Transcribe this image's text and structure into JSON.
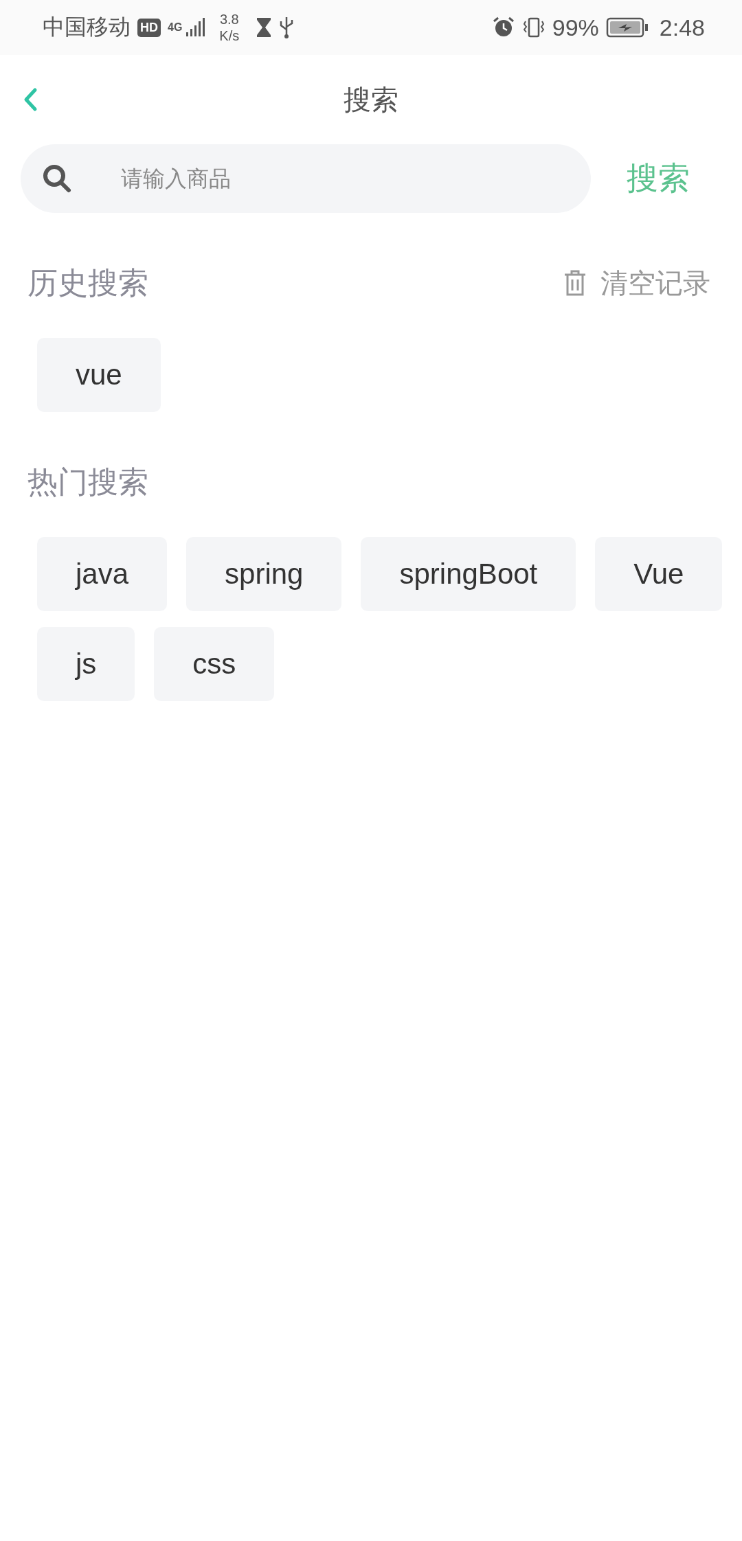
{
  "status_bar": {
    "carrier": "中国移动",
    "hd_badge": "HD",
    "network": "4G",
    "speed_value": "3.8",
    "speed_unit": "K/s",
    "battery": "99%",
    "time": "2:48"
  },
  "nav": {
    "title": "搜索"
  },
  "search": {
    "placeholder": "请输入商品",
    "button": "搜索"
  },
  "history": {
    "title": "历史搜索",
    "clear": "清空记录",
    "tags": [
      "vue"
    ]
  },
  "hot": {
    "title": "热门搜索",
    "tags": [
      "java",
      "spring",
      "springBoot",
      "Vue",
      "js",
      "css"
    ]
  }
}
